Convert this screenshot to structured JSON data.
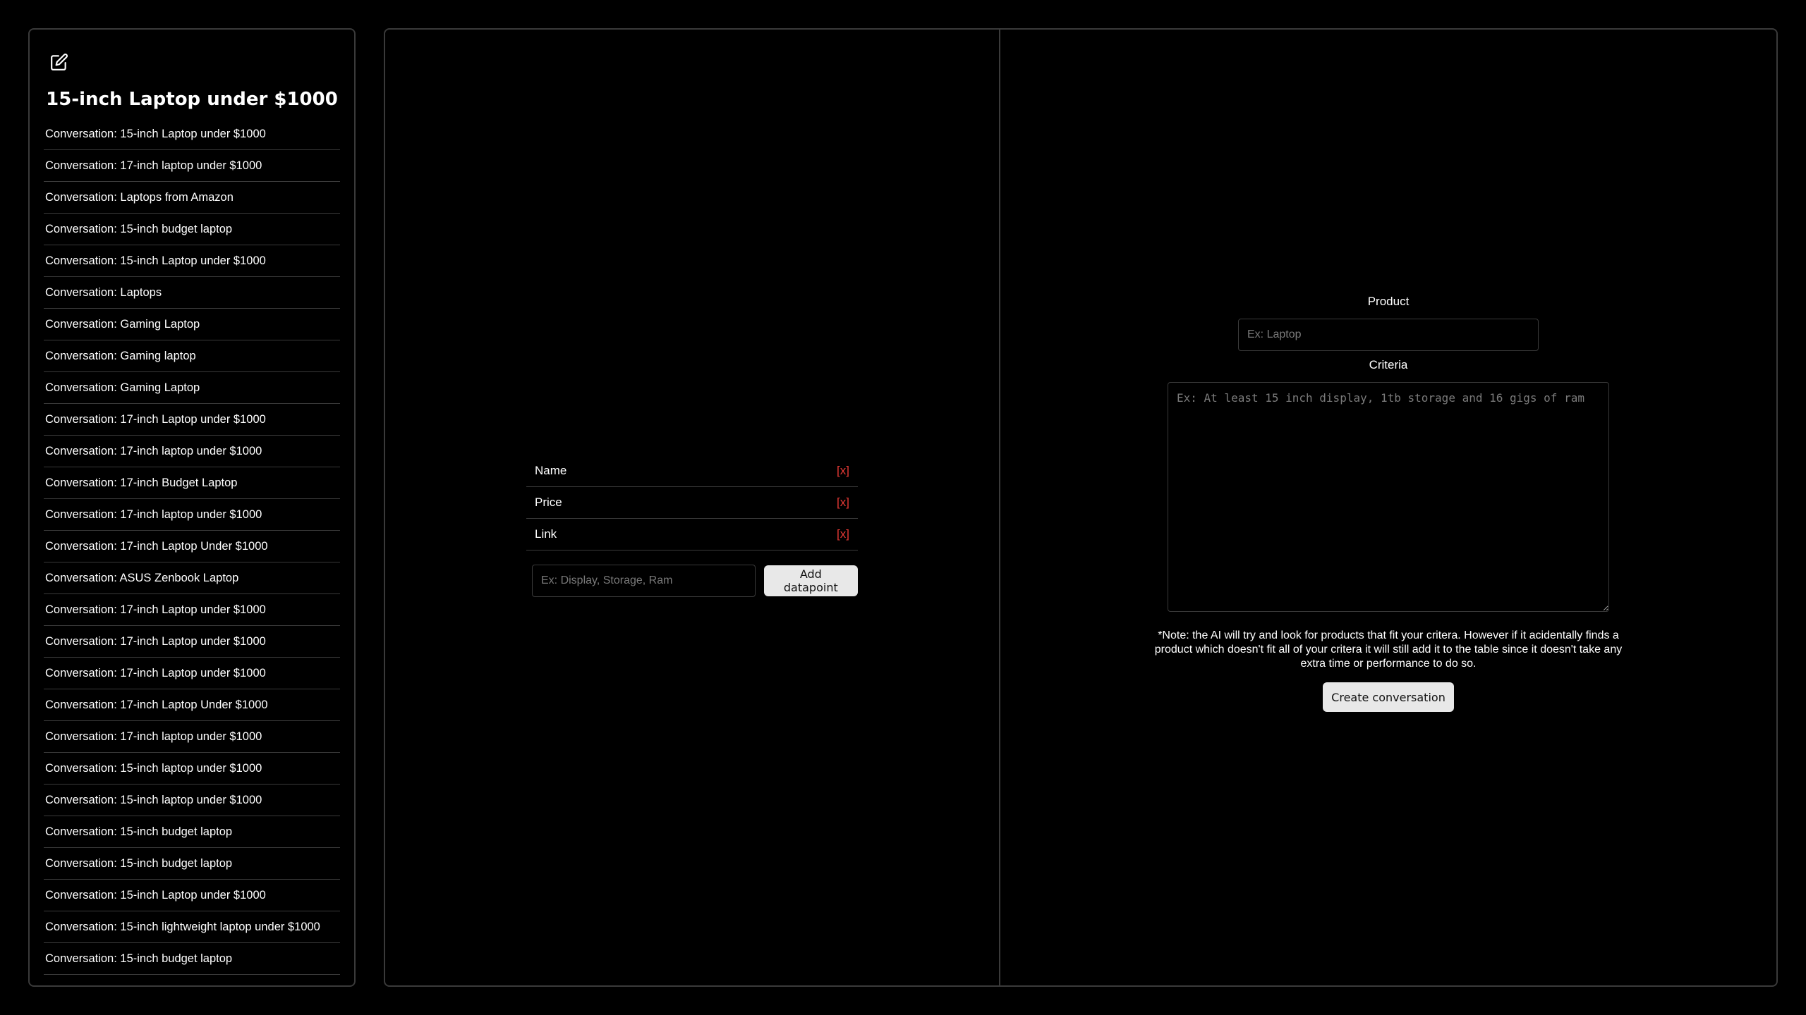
{
  "sidebar": {
    "edit_icon": "edit-icon",
    "title": "15-inch Laptop under $1000",
    "conversations": [
      "Conversation: 15-inch Laptop under $1000",
      "Conversation: 17-inch laptop under $1000",
      "Conversation: Laptops from Amazon",
      "Conversation: 15-inch budget laptop",
      "Conversation: 15-inch Laptop under $1000",
      "Conversation: Laptops",
      "Conversation: Gaming Laptop",
      "Conversation: Gaming laptop",
      "Conversation: Gaming Laptop",
      "Conversation: 17-inch Laptop under $1000",
      "Conversation: 17-inch laptop under $1000",
      "Conversation: 17-inch Budget Laptop",
      "Conversation: 17-inch laptop under $1000",
      "Conversation: 17-inch Laptop Under $1000",
      "Conversation: ASUS Zenbook Laptop",
      "Conversation: 17-inch Laptop under $1000",
      "Conversation: 17-inch Laptop under $1000",
      "Conversation: 17-inch Laptop under $1000",
      "Conversation: 17-inch Laptop Under $1000",
      "Conversation: 17-inch laptop under $1000",
      "Conversation: 15-inch laptop under $1000",
      "Conversation: 15-inch laptop under $1000",
      "Conversation: 15-inch budget laptop",
      "Conversation: 15-inch budget laptop",
      "Conversation: 15-inch Laptop under $1000",
      "Conversation: 15-inch lightweight laptop under $1000",
      "Conversation: 15-inch budget laptop"
    ]
  },
  "datapoints": {
    "items": [
      {
        "label": "Name",
        "remove": "[x]"
      },
      {
        "label": "Price",
        "remove": "[x]"
      },
      {
        "label": "Link",
        "remove": "[x]"
      }
    ],
    "input_placeholder": "Ex: Display, Storage, Ram",
    "add_label": "Add datapoint"
  },
  "form": {
    "product_label": "Product",
    "product_placeholder": "Ex: Laptop",
    "criteria_label": "Criteria",
    "criteria_placeholder": "Ex: At least 15 inch display, 1tb storage and 16 gigs of ram",
    "note": "*Note: the AI will try and look for products that fit your critera. However if it acidentally finds a product which doesn't fit all of your critera it will still add it to the table since it doesn't take any extra time or performance to do so.",
    "create_label": "Create conversation"
  },
  "colors": {
    "background": "#000000",
    "border": "#3a3a3a",
    "remove": "#e53935",
    "button": "#e8e8e8"
  }
}
